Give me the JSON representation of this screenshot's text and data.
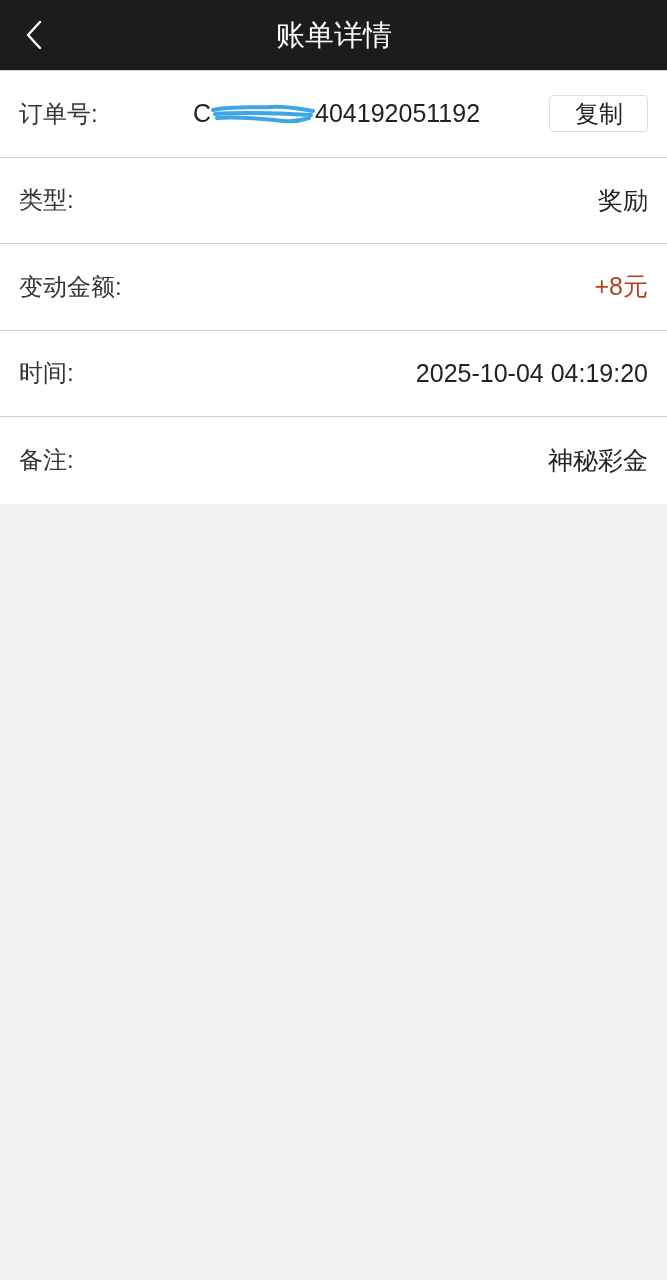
{
  "header": {
    "title": "账单详情"
  },
  "rows": [
    {
      "kind": "order",
      "label": "订单号:",
      "value_start": "C",
      "value_end": "404192051192",
      "redacted": true,
      "button": "复制"
    },
    {
      "kind": "text",
      "label": "类型:",
      "value": "奖励"
    },
    {
      "kind": "amount",
      "label": "变动金额:",
      "value": "+8元"
    },
    {
      "kind": "text",
      "label": "时间:",
      "value": "2025-10-04 04:19:20"
    },
    {
      "kind": "text",
      "label": "备注:",
      "value": "神秘彩金"
    }
  ]
}
